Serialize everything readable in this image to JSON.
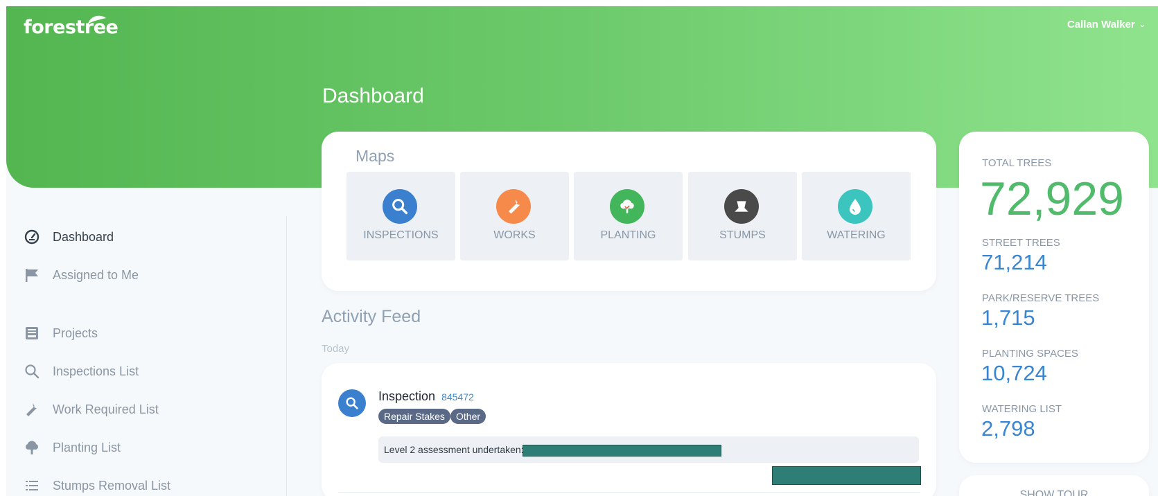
{
  "header": {
    "logo_text": "forestree",
    "user_name": "Callan Walker",
    "page_title": "Dashboard"
  },
  "sidebar": {
    "items": [
      {
        "label": "Dashboard",
        "icon": "gauge-icon",
        "active": true
      },
      {
        "label": "Assigned to Me",
        "icon": "flag-icon"
      },
      {
        "label": "Projects",
        "icon": "inbox-icon"
      },
      {
        "label": "Inspections List",
        "icon": "search-icon"
      },
      {
        "label": "Work Required List",
        "icon": "wrench-icon"
      },
      {
        "label": "Planting List",
        "icon": "tree-icon"
      },
      {
        "label": "Stumps Removal List",
        "icon": "list-icon"
      }
    ]
  },
  "maps": {
    "title": "Maps",
    "tiles": [
      {
        "label": "INSPECTIONS",
        "icon": "search-icon",
        "color": "#3a80cf"
      },
      {
        "label": "WORKS",
        "icon": "wrench-icon",
        "color": "#f58a4b"
      },
      {
        "label": "PLANTING",
        "icon": "tree-icon",
        "color": "#43b55a"
      },
      {
        "label": "STUMPS",
        "icon": "stump-icon",
        "color": "#4a4a4a"
      },
      {
        "label": "WATERING",
        "icon": "droplet-icon",
        "color": "#3cc5bf"
      }
    ]
  },
  "feed": {
    "title": "Activity Feed",
    "day": "Today",
    "item": {
      "type": "Inspection",
      "id": "845472",
      "tags": [
        "Repair Stakes",
        "Other"
      ],
      "note": "Level 2 assessment undertaken:"
    }
  },
  "stats": {
    "total_label": "TOTAL TREES",
    "total_value": "72,929",
    "items": [
      {
        "label": "STREET TREES",
        "value": "71,214"
      },
      {
        "label": "PARK/RESERVE TREES",
        "value": "1,715"
      },
      {
        "label": "PLANTING SPACES",
        "value": "10,724"
      },
      {
        "label": "WATERING LIST",
        "value": "2,798"
      }
    ]
  },
  "tour": {
    "label": "SHOW TOUR"
  },
  "colors": {
    "brand_green": "#53b650",
    "accent_blue": "#3a85d0",
    "total_green": "#4fbb6b"
  }
}
